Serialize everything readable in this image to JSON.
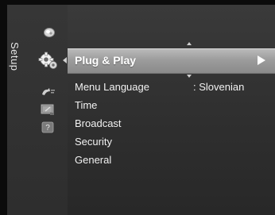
{
  "side": {
    "section_label": "Setup",
    "icons": [
      "picture-icon",
      "setup-gear-icon",
      "input-icon",
      "application-icon",
      "support-icon"
    ]
  },
  "selected_item": {
    "label": "Plug & Play"
  },
  "menu_items": [
    {
      "label": "Menu Language",
      "value": ": Slovenian"
    },
    {
      "label": "Time",
      "value": ""
    },
    {
      "label": "Broadcast",
      "value": ""
    },
    {
      "label": "Security",
      "value": ""
    },
    {
      "label": "General",
      "value": ""
    }
  ],
  "colors": {
    "panel": "#333333",
    "highlight": "#a8a8a8",
    "text": "#f2f2f2"
  }
}
